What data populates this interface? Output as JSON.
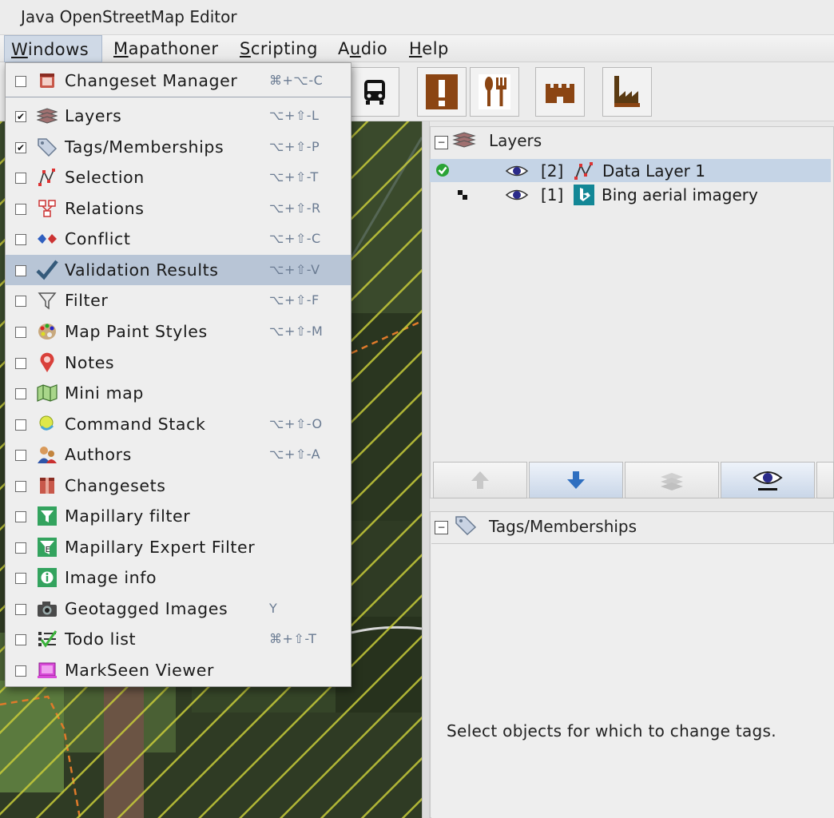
{
  "window": {
    "title": "Java OpenStreetMap Editor"
  },
  "menubar": {
    "items": [
      {
        "label": "Windows",
        "mnemonic": "W"
      },
      {
        "label": "Mapathoner",
        "mnemonic": "M"
      },
      {
        "label": "Scripting",
        "mnemonic": "S"
      },
      {
        "label": "Audio",
        "mnemonic": "u"
      },
      {
        "label": "Help",
        "mnemonic": "H"
      }
    ],
    "active": "Windows"
  },
  "toolbar": {
    "buttons": [
      "bus-icon",
      "exclamation-icon",
      "restaurant-icon",
      "castle-icon",
      "factory-icon"
    ]
  },
  "windows_menu": {
    "items": [
      {
        "label": "Changeset Manager",
        "shortcut": "⌘+⌥-C",
        "checked": false,
        "icon": "changeset-manager-icon"
      },
      {
        "label": "Layers",
        "shortcut": "⌥+⇧-L",
        "checked": true,
        "icon": "layers-icon"
      },
      {
        "label": "Tags/Memberships",
        "shortcut": "⌥+⇧-P",
        "checked": true,
        "icon": "tags-icon"
      },
      {
        "label": "Selection",
        "shortcut": "⌥+⇧-T",
        "checked": false,
        "icon": "selection-icon"
      },
      {
        "label": "Relations",
        "shortcut": "⌥+⇧-R",
        "checked": false,
        "icon": "relations-icon"
      },
      {
        "label": "Conflict",
        "shortcut": "⌥+⇧-C",
        "checked": false,
        "icon": "conflict-icon"
      },
      {
        "label": "Validation Results",
        "shortcut": "⌥+⇧-V",
        "checked": false,
        "icon": "validation-checkmark-icon",
        "highlighted": true
      },
      {
        "label": "Filter",
        "shortcut": "⌥+⇧-F",
        "checked": false,
        "icon": "filter-funnel-icon"
      },
      {
        "label": "Map Paint Styles",
        "shortcut": "⌥+⇧-M",
        "checked": false,
        "icon": "palette-icon"
      },
      {
        "label": "Notes",
        "shortcut": "",
        "checked": false,
        "icon": "notes-pin-icon"
      },
      {
        "label": "Mini map",
        "shortcut": "",
        "checked": false,
        "icon": "minimap-icon"
      },
      {
        "label": "Command Stack",
        "shortcut": "⌥+⇧-O",
        "checked": false,
        "icon": "command-stack-icon"
      },
      {
        "label": "Authors",
        "shortcut": "⌥+⇧-A",
        "checked": false,
        "icon": "authors-icon"
      },
      {
        "label": "Changesets",
        "shortcut": "",
        "checked": false,
        "icon": "changesets-icon"
      },
      {
        "label": "Mapillary filter",
        "shortcut": "",
        "checked": false,
        "icon": "mapillary-filter-icon"
      },
      {
        "label": "Mapillary Expert Filter",
        "shortcut": "",
        "checked": false,
        "icon": "mapillary-expert-filter-icon"
      },
      {
        "label": "Image info",
        "shortcut": "",
        "checked": false,
        "icon": "image-info-icon"
      },
      {
        "label": "Geotagged Images",
        "shortcut": "Y",
        "checked": false,
        "icon": "camera-icon"
      },
      {
        "label": "Todo list",
        "shortcut": "⌘+⇧-T",
        "checked": false,
        "icon": "todo-list-icon"
      },
      {
        "label": "MarkSeen Viewer",
        "shortcut": "",
        "checked": false,
        "icon": "markseen-icon"
      }
    ]
  },
  "layers_panel": {
    "title": "Layers",
    "layers": [
      {
        "index": "[2]",
        "name": "Data Layer 1",
        "selected": true
      },
      {
        "index": "[1]",
        "name": "Bing aerial imagery",
        "selected": false
      }
    ]
  },
  "tags_panel": {
    "title": "Tags/Memberships",
    "empty_message": "Select objects for which to change tags."
  },
  "colors": {
    "menu_highlight": "#b8c5d6",
    "selected_row": "#c5d4e6",
    "poi_brown": "#8b4513",
    "shortcut_text": "#6a7b92"
  }
}
